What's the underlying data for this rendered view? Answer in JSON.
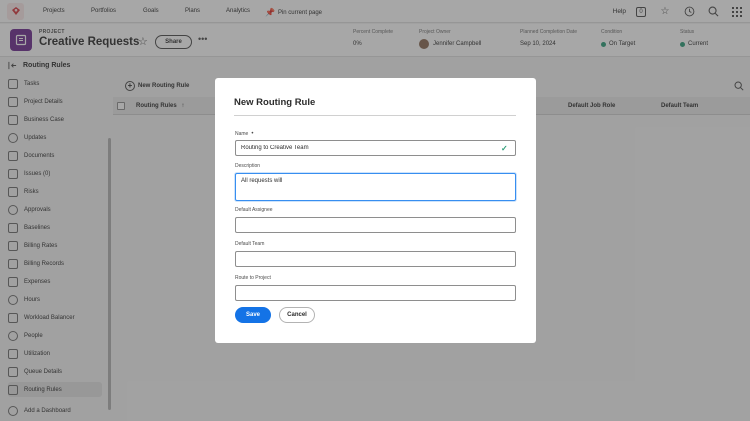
{
  "topnav": {
    "items": [
      "Projects",
      "Portfolios",
      "Goals",
      "Plans",
      "Analytics"
    ],
    "pin_label": "Pin current page",
    "help": "Help",
    "notifications_count": "0"
  },
  "project": {
    "kicker": "PROJECT",
    "title": "Creative Requests",
    "share": "Share",
    "more": "•••",
    "meta": [
      {
        "label": "Percent Complete",
        "value": "0%"
      },
      {
        "label": "Project Owner",
        "value": "Jennifer Campbell"
      },
      {
        "label": "Planned Completion Date",
        "value": "Sep 10, 2024"
      },
      {
        "label": "Condition",
        "value": "On Target"
      },
      {
        "label": "Status",
        "value": "Current"
      }
    ]
  },
  "sidebar": {
    "header": "Routing Rules",
    "items": [
      {
        "label": "Tasks"
      },
      {
        "label": "Project Details"
      },
      {
        "label": "Business Case"
      },
      {
        "label": "Updates"
      },
      {
        "label": "Documents"
      },
      {
        "label": "Issues (0)"
      },
      {
        "label": "Risks"
      },
      {
        "label": "Approvals"
      },
      {
        "label": "Baselines"
      },
      {
        "label": "Billing Rates"
      },
      {
        "label": "Billing Records"
      },
      {
        "label": "Expenses"
      },
      {
        "label": "Hours"
      },
      {
        "label": "Workload Balancer"
      },
      {
        "label": "People"
      },
      {
        "label": "Utilization"
      },
      {
        "label": "Queue Details"
      },
      {
        "label": "Routing Rules"
      },
      {
        "label": "Add a Dashboard"
      }
    ]
  },
  "main": {
    "new_button": "New Routing Rule",
    "columns": [
      "Routing Rules",
      "Default Job Role",
      "Default Team"
    ],
    "sort_indicator": "↑"
  },
  "modal": {
    "title": "New Routing Rule",
    "name_label": "Name",
    "name_required": "•",
    "name_value": "Routing to Creative Team",
    "description_label": "Description",
    "description_value": "All requests will",
    "assignee_label": "Default Assignee",
    "assignee_value": "",
    "team_label": "Default Team",
    "team_value": "",
    "project_label": "Route to Project",
    "project_value": "",
    "save": "Save",
    "cancel": "Cancel"
  },
  "colors": {
    "accent": "#1473e6",
    "project_icon": "#6e2d91",
    "on_target": "#2d9d78"
  }
}
